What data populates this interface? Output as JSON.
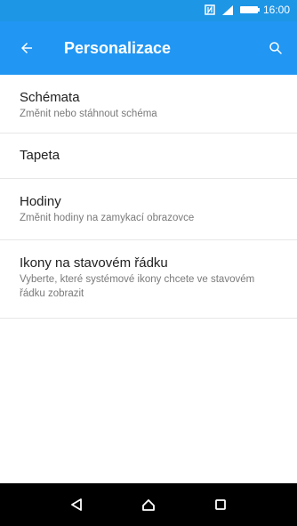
{
  "status_bar": {
    "time": "16:00",
    "icons": [
      "nfc-icon",
      "signal-icon",
      "battery-icon"
    ]
  },
  "app_bar": {
    "title": "Personalizace",
    "back_icon": "back-arrow-icon",
    "search_icon": "search-icon",
    "color": "#2196f3"
  },
  "settings": {
    "items": [
      {
        "title": "Schémata",
        "subtitle": "Změnit nebo stáhnout schéma"
      },
      {
        "title": "Tapeta",
        "subtitle": ""
      },
      {
        "title": "Hodiny",
        "subtitle": "Změnit hodiny na zamykací obrazovce"
      },
      {
        "title": "Ikony na stavovém řádku",
        "subtitle": "Vyberte, které systémové ikony chcete ve stavovém řádku zobrazit"
      }
    ]
  },
  "nav_bar": {
    "buttons": [
      "back-triangle-icon",
      "home-icon",
      "recents-icon"
    ]
  }
}
